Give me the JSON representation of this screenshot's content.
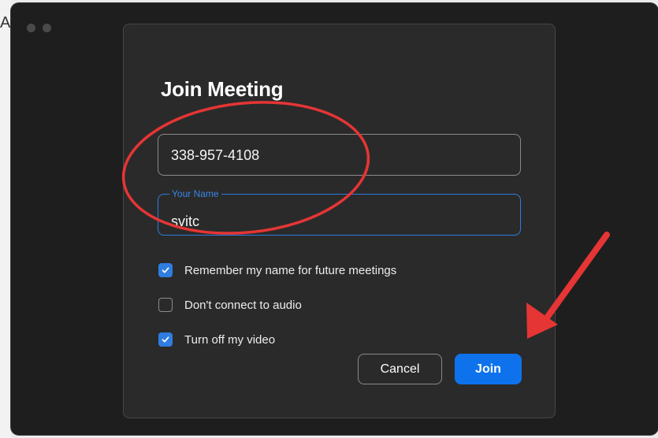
{
  "behind_window": {
    "edge_glyph": "A"
  },
  "window": {
    "traffic_lights": [
      "close",
      "minimize"
    ]
  },
  "dialog": {
    "title": "Join Meeting",
    "meeting_id": {
      "value": "338-957-4108"
    },
    "your_name": {
      "legend": "Your Name",
      "value": "svitc"
    },
    "options": [
      {
        "label": "Remember my name for future meetings",
        "checked": true
      },
      {
        "label": "Don't connect to audio",
        "checked": false
      },
      {
        "label": "Turn off my video",
        "checked": true
      }
    ],
    "buttons": {
      "cancel": "Cancel",
      "join": "Join"
    }
  },
  "colors": {
    "accent": "#0e72ed",
    "dialog_bg": "#2a2a2a",
    "window_bg": "#1e1e1e",
    "annotation_red": "#e53535"
  },
  "annotations": {
    "highlight_ellipse": "red-ellipse",
    "pointer_arrow": "red-arrow"
  }
}
